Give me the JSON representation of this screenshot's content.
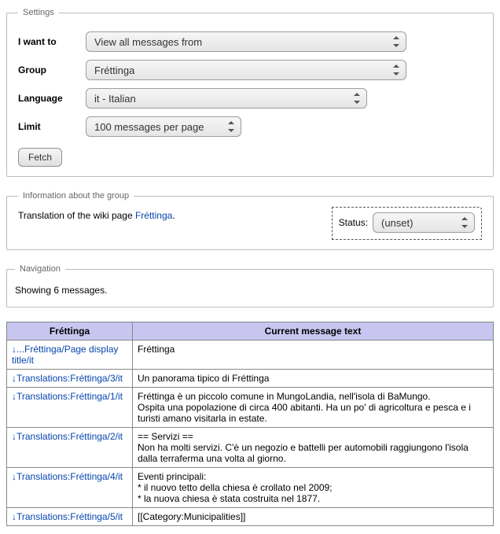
{
  "settings": {
    "legend": "Settings",
    "iwantto_label": "I want to",
    "iwantto_value": "View all messages from",
    "group_label": "Group",
    "group_value": "Fréttinga",
    "language_label": "Language",
    "language_value": "it - Italian",
    "limit_label": "Limit",
    "limit_value": "100 messages per page",
    "fetch_label": "Fetch"
  },
  "info": {
    "legend": "Information about the group",
    "text_prefix": "Translation of the wiki page ",
    "link_text": "Fréttinga",
    "text_suffix": ".",
    "status_label": "Status:",
    "status_value": "(unset)"
  },
  "nav": {
    "legend": "Navigation",
    "showing": "Showing 6 messages."
  },
  "table": {
    "col1": "Fréttinga",
    "col2": "Current message text",
    "rows": [
      {
        "key_arrow": "↓",
        "key": "...Fréttinga/Page display title/it",
        "text": "Fréttinga"
      },
      {
        "key_arrow": "↓",
        "key": "Translations:Fréttinga/3/it",
        "text": "Un panorama tipico di Fréttinga"
      },
      {
        "key_arrow": "↓",
        "key": "Translations:Fréttinga/1/it",
        "text": "Fréttinga è un piccolo comune in MungoLandia, nell'isola di BaMungo.\nOspita una popolazione di circa 400 abitanti. Ha un po' di agricoltura e pesca e i turisti amano visitarla in estate."
      },
      {
        "key_arrow": "↓",
        "key": "Translations:Fréttinga/2/it",
        "text": "== Servizi ==\nNon ha molti servizi. C'è un negozio e battelli per automobili raggiungono l'isola dalla terraferma una volta al giorno."
      },
      {
        "key_arrow": "↓",
        "key": "Translations:Fréttinga/4/it",
        "text": "Eventi principali:\n* il nuovo tetto della chiesa è crollato nel 2009;\n* la nuova chiesa è stata costruita nel 1877."
      },
      {
        "key_arrow": "↓",
        "key": "Translations:Fréttinga/5/it",
        "text": "[[Category:Municipalities]]"
      }
    ]
  }
}
